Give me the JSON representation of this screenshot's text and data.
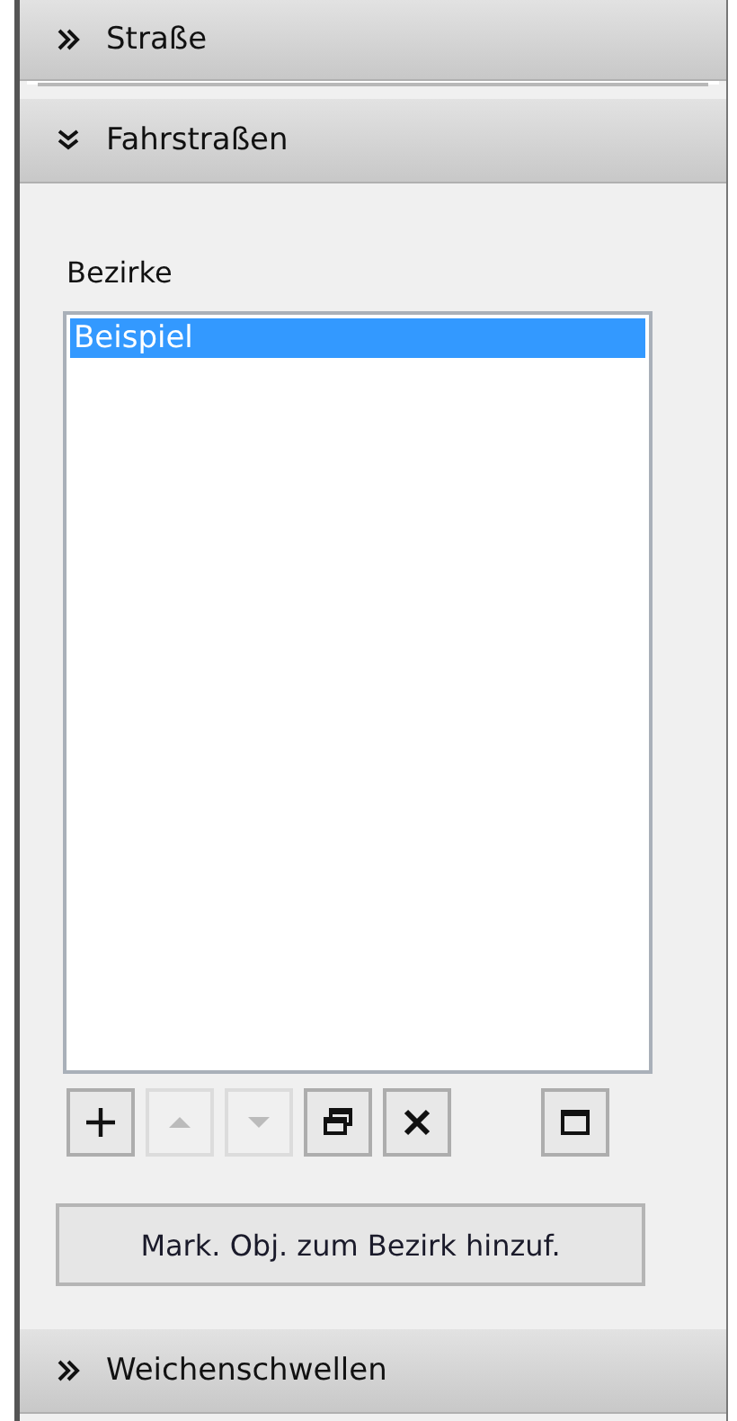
{
  "sections": [
    {
      "title": "Straße",
      "expanded": false
    },
    {
      "title": "Fahrstraßen",
      "expanded": true,
      "list_label": "Bezirke",
      "list_items": [
        {
          "label": "Beispiel",
          "selected": true
        }
      ],
      "tools": [
        {
          "kind": "add",
          "disabled": false
        },
        {
          "kind": "up",
          "disabled": true
        },
        {
          "kind": "down",
          "disabled": true
        },
        {
          "kind": "restore",
          "disabled": false
        },
        {
          "kind": "delete",
          "disabled": false
        },
        {
          "kind": "maximize",
          "disabled": false
        }
      ],
      "action_button": "Mark. Obj. zum Bezirk hinzuf."
    },
    {
      "title": "Weichenschwellen",
      "expanded": false
    }
  ]
}
